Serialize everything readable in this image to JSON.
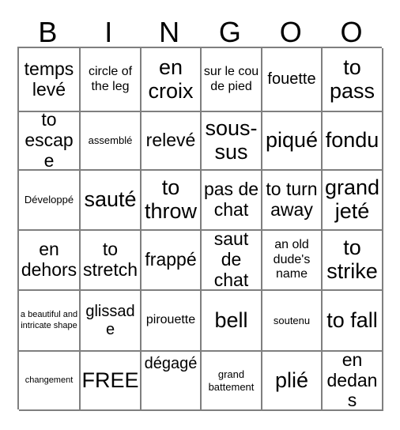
{
  "card": {
    "headers": [
      "B",
      "I",
      "N",
      "G",
      "O",
      "O"
    ],
    "rows": [
      [
        {
          "text": "temps levé",
          "size": "lg"
        },
        {
          "text": "circle of the leg",
          "size": "sm"
        },
        {
          "text": "en croix",
          "size": "xl"
        },
        {
          "text": "sur le cou de pied",
          "size": "sm"
        },
        {
          "text": "fouette",
          "size": "md"
        },
        {
          "text": "to pass",
          "size": "xl"
        }
      ],
      [
        {
          "text": "to escape",
          "size": "lg"
        },
        {
          "text": "assemblé",
          "size": "xs"
        },
        {
          "text": "relevé",
          "size": "lg"
        },
        {
          "text": "sous-sus",
          "size": "xl"
        },
        {
          "text": "piqué",
          "size": "xl"
        },
        {
          "text": "fondu",
          "size": "xl"
        }
      ],
      [
        {
          "text": "Développé",
          "size": "xs"
        },
        {
          "text": "sauté",
          "size": "xl"
        },
        {
          "text": "to throw",
          "size": "xl"
        },
        {
          "text": "pas de chat",
          "size": "lg"
        },
        {
          "text": "to turn away",
          "size": "lg"
        },
        {
          "text": "grand jeté",
          "size": "xl"
        }
      ],
      [
        {
          "text": "en dehors",
          "size": "lg"
        },
        {
          "text": "to stretch",
          "size": "lg"
        },
        {
          "text": "frappé",
          "size": "lg"
        },
        {
          "text": "saut de chat",
          "size": "lg"
        },
        {
          "text": "an old dude's name",
          "size": "sm"
        },
        {
          "text": "to strike",
          "size": "xl"
        }
      ],
      [
        {
          "text": "a beautiful and intricate shape",
          "size": "xxs"
        },
        {
          "text": "glissade",
          "size": "md"
        },
        {
          "text": "pirouette",
          "size": "sm"
        },
        {
          "text": "bell",
          "size": "xl"
        },
        {
          "text": "soutenu",
          "size": "xs"
        },
        {
          "text": "to fall",
          "size": "xl"
        }
      ],
      [
        {
          "text": "changement",
          "size": "xxs"
        },
        {
          "text": "FREE",
          "size": "xl"
        },
        {
          "text": "dégagé",
          "size": "md",
          "align": "top"
        },
        {
          "text": "grand battement",
          "size": "xs"
        },
        {
          "text": "plié",
          "size": "xl"
        },
        {
          "text": "en dedans",
          "size": "lg"
        }
      ]
    ]
  }
}
